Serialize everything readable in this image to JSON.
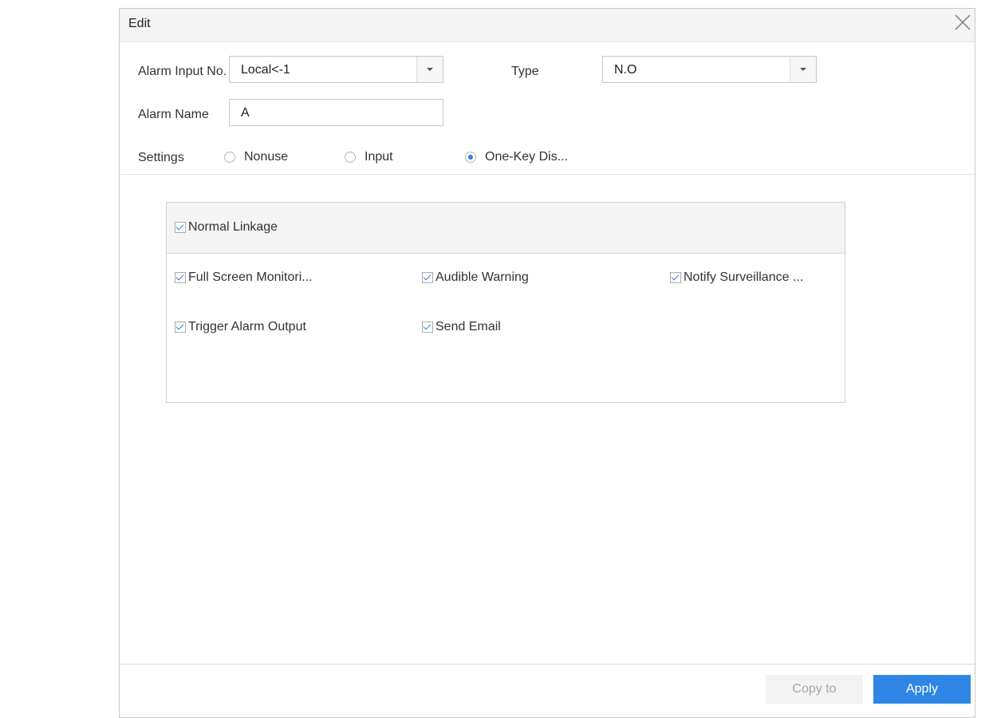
{
  "dialog": {
    "title": "Edit",
    "close_icon": "close-icon"
  },
  "form": {
    "alarm_input_label": "Alarm Input No.",
    "alarm_input_value": "Local<-1",
    "type_label": "Type",
    "type_value": "N.O",
    "alarm_name_label": "Alarm Name",
    "alarm_name_value": "A",
    "settings_label": "Settings",
    "settings_options": [
      {
        "label": "Nonuse",
        "selected": false
      },
      {
        "label": "Input",
        "selected": false
      },
      {
        "label": "One-Key Dis...",
        "selected": true
      }
    ]
  },
  "linkage": {
    "header": {
      "label": "Normal Linkage",
      "checked": true
    },
    "items": [
      {
        "label": "Full Screen Monitori...",
        "checked": true
      },
      {
        "label": "Audible Warning",
        "checked": true
      },
      {
        "label": "Notify Surveillance ...",
        "checked": true
      },
      {
        "label": "Trigger Alarm Output",
        "checked": true
      },
      {
        "label": "Send Email",
        "checked": true
      }
    ]
  },
  "footer": {
    "copy_label": "Copy to",
    "apply_label": "Apply"
  },
  "colors": {
    "accent": "#2f86e6",
    "radio_selected": "#2f7de1"
  }
}
